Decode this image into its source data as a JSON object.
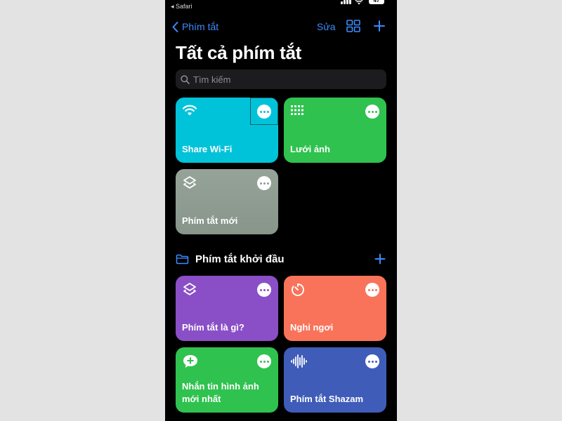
{
  "status_bar": {
    "back_app": "◂ Safari",
    "battery": "47"
  },
  "nav": {
    "back_label": "Phím tắt",
    "edit_label": "Sửa"
  },
  "page_title": "Tất cả phím tắt",
  "search": {
    "placeholder": "Tìm kiếm"
  },
  "shortcuts": [
    {
      "label": "Share Wi-Fi",
      "icon": "wifi-icon",
      "color": "#00c3d9"
    },
    {
      "label": "Lưới ảnh",
      "icon": "grid-dots-icon",
      "color": "#2fc24f"
    },
    {
      "label": "Phím tắt mới",
      "icon": "layers-icon",
      "color": "#8e9e91"
    }
  ],
  "starter_section": {
    "title": "Phím tắt khởi đầu",
    "shortcuts": [
      {
        "label": "Phím tắt là gì?",
        "icon": "layers-icon",
        "color": "#8a4fc7"
      },
      {
        "label": "Nghỉ ngơi",
        "icon": "timer-icon",
        "color": "#f8735a"
      },
      {
        "label": "Nhắn tin hình ảnh mới nhất",
        "icon": "message-plus-icon",
        "color": "#2fc24f"
      },
      {
        "label": "Phím tắt Shazam",
        "icon": "waveform-icon",
        "color": "#3f5cb8"
      }
    ]
  },
  "colors": {
    "accent": "#3b8cff",
    "background": "#000000",
    "search_bg": "#1c1c1e"
  }
}
